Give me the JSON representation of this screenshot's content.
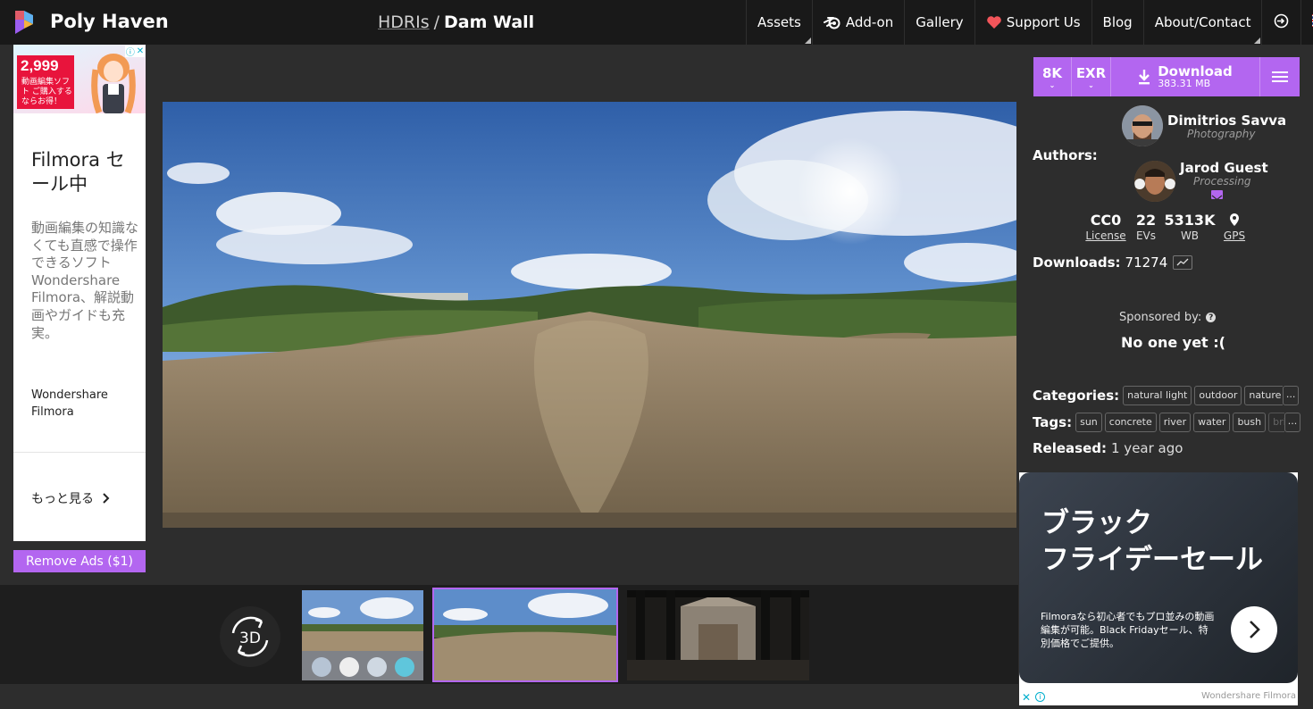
{
  "header": {
    "brand": "Poly Haven",
    "breadcrumb_link": "HDRIs",
    "breadcrumb_sep": "/",
    "title": "Dam Wall",
    "nav": {
      "assets": "Assets",
      "addon": "Add-on",
      "gallery": "Gallery",
      "support": "Support Us",
      "blog": "Blog",
      "about": "About/Contact"
    },
    "icons": [
      "polyhaven-logo-icon",
      "blender-icon",
      "heart-icon",
      "login-icon",
      "uk-flag-icon"
    ]
  },
  "left_ad": {
    "price": "2,999",
    "price_tag": "動画編集ソフト ご購入するならお得！",
    "title": "Filmora セール中",
    "description": "動画編集の知識なくても直感で操作できるソフトWondershare Filmora、解説動画やガイドも充実。",
    "brand": "Wondershare Filmora",
    "more": "もっと見る",
    "remove_ads": "Remove Ads ($1)"
  },
  "download": {
    "resolution": "8K",
    "format": "EXR",
    "label": "Download",
    "size": "383.31 MB"
  },
  "authors": {
    "label": "Authors:",
    "list": [
      {
        "name": "Dimitrios Savva",
        "role": "Photography"
      },
      {
        "name": "Jarod Guest",
        "role": "Processing"
      }
    ]
  },
  "stats": {
    "license": {
      "value": "CC0",
      "label": "License"
    },
    "evs": {
      "value": "22",
      "label": "EVs"
    },
    "wb": {
      "value": "5313K",
      "label": "WB"
    },
    "gps": {
      "label": "GPS"
    }
  },
  "downloads": {
    "label": "Downloads:",
    "value": "71274"
  },
  "sponsor": {
    "label": "Sponsored by:",
    "value": "No one yet :("
  },
  "categories": {
    "label": "Categories:",
    "items": [
      "natural light",
      "outdoor",
      "nature",
      "p"
    ],
    "more": "..."
  },
  "tags": {
    "label": "Tags:",
    "items": [
      "sun",
      "concrete",
      "river",
      "water",
      "bush",
      "brid"
    ],
    "more": "..."
  },
  "released": {
    "label": "Released:",
    "value": "1 year ago"
  },
  "viewer": {
    "button_3d": "3D"
  },
  "right_ad": {
    "title_line1": "ブラック",
    "title_line2": "フライデーセール",
    "text": "Filmoraなら初心者でもプロ並みの動画編集が可能。Black Fridayセール、特別価格でご提供。",
    "brand": "Wondershare Filmora",
    "close": "✕",
    "info": "i"
  },
  "colors": {
    "accent": "#b366f0",
    "header_bg": "#191919",
    "page_bg": "#2d2d2d",
    "strip_bg": "#1e1e1e"
  }
}
